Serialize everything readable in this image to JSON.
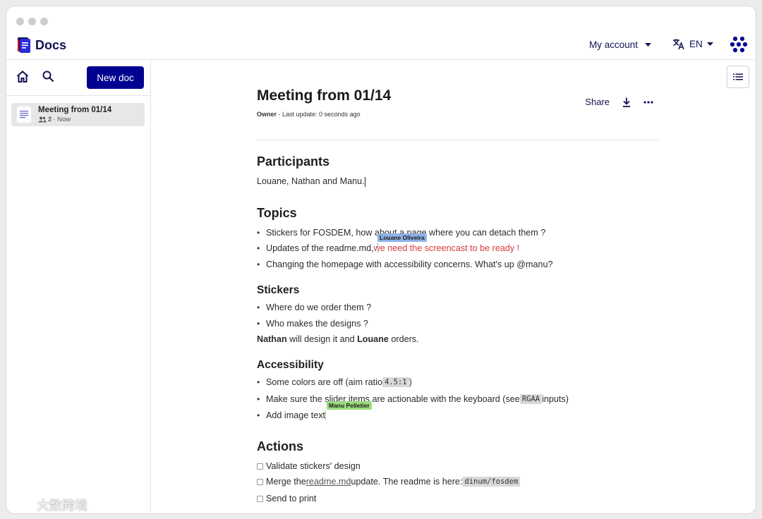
{
  "app": {
    "name": "Docs"
  },
  "header": {
    "account_label": "My account",
    "language": "EN"
  },
  "sidebar": {
    "new_doc_label": "New doc",
    "docs": [
      {
        "title": "Meeting from 01/14",
        "members": "2",
        "updated": "· Now"
      }
    ]
  },
  "document": {
    "title": "Meeting from 01/14",
    "role": "Owner",
    "last_update": " - Last update: 0 seconds ago",
    "actions": {
      "share_label": "Share"
    },
    "sections": {
      "participants": {
        "heading": "Participants",
        "text": "Louane, Nathan and Manu."
      },
      "topics": {
        "heading": "Topics",
        "items": [
          "Stickers for FOSDEM, how about a page where you can detach them ?",
          "Updates of the readme.md, ",
          "Changing the homepage with accessibility concerns. What's up @manu?"
        ],
        "highlight": "we need the screencast to be ready !"
      },
      "stickers": {
        "heading": "Stickers",
        "items": [
          "Where do we order them ?",
          "Who makes the designs ?"
        ],
        "note": {
          "name1": "Nathan",
          "mid": " will design it and ",
          "name2": "Louane",
          "end": " orders."
        }
      },
      "accessibility": {
        "heading": "Accessibility",
        "item1": {
          "pre": "Some colors are off (aim ratio ",
          "code": "4.5:1",
          "post": ")"
        },
        "item2": {
          "pre": "Make sure the slider items are actionable with the keyboard (see ",
          "code": "RGAA",
          "post": " inputs)"
        },
        "item3": "Add image text"
      },
      "actions": {
        "heading": "Actions",
        "item1": "Validate stickers' design",
        "item2": {
          "pre": "Merge the ",
          "link": "readme.md",
          "mid": " update. The readme is here: ",
          "code": "dinum/fosdem"
        },
        "item3": "Send to print"
      }
    }
  },
  "collaborators": [
    {
      "name": "Louane Oliveira",
      "color": "#8fb2e6"
    },
    {
      "name": "Manu Pelletier",
      "color": "#9bdc7f"
    }
  ],
  "colors": {
    "primary": "#000091",
    "highlight_text": "#d83a3a"
  },
  "watermark": "大数跨境"
}
